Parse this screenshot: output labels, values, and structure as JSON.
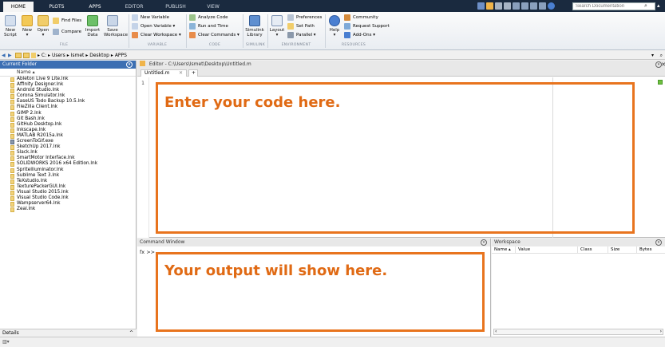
{
  "tabs": [
    {
      "label": "HOME"
    },
    {
      "label": "PLOTS"
    },
    {
      "label": "APPS"
    },
    {
      "label": "EDITOR"
    },
    {
      "label": "PUBLISH"
    },
    {
      "label": "VIEW"
    }
  ],
  "search": {
    "placeholder": "Search Documentation"
  },
  "ribbon": {
    "new_script": "New Script",
    "new": "New",
    "open": "Open",
    "find_files": "Find Files",
    "compare": "Compare",
    "import_data": "Import Data",
    "save_workspace": "Save Workspace",
    "new_variable": "New Variable",
    "open_variable": "Open Variable",
    "clear_workspace": "Clear Workspace",
    "analyze_code": "Analyze Code",
    "run_and_time": "Run and Time",
    "clear_commands": "Clear Commands",
    "simulink_library": "Simulink Library",
    "layout": "Layout",
    "preferences": "Preferences",
    "set_path": "Set Path",
    "parallel": "Parallel",
    "help": "Help",
    "community": "Community",
    "request_support": "Request Support",
    "add_ons": "Add-Ons",
    "sections": {
      "file": "FILE",
      "variable": "VARIABLE",
      "code": "CODE",
      "simulink": "SIMULINK",
      "environment": "ENVIRONMENT",
      "resources": "RESOURCES"
    }
  },
  "address": {
    "crumbs": [
      "C:",
      "Users",
      "Ismet",
      "Desktop",
      "APPS"
    ]
  },
  "current_folder": {
    "title": "Current Folder",
    "name_col": "Name",
    "files": [
      {
        "name": "Ableton Live 9 Lite.lnk",
        "icon": "file-icon"
      },
      {
        "name": "Affinity Designer.lnk",
        "icon": "file-icon"
      },
      {
        "name": "Android Studio.lnk",
        "icon": "file-icon"
      },
      {
        "name": "Corona Simulator.lnk",
        "icon": "file-icon"
      },
      {
        "name": "EaseUS Todo Backup 10.5.lnk",
        "icon": "file-icon"
      },
      {
        "name": "FileZilla Client.lnk",
        "icon": "file-icon"
      },
      {
        "name": "GIMP 2.lnk",
        "icon": "file-icon"
      },
      {
        "name": "Git Bash.lnk",
        "icon": "file-icon"
      },
      {
        "name": "GitHub Desktop.lnk",
        "icon": "file-icon"
      },
      {
        "name": "Inkscape.lnk",
        "icon": "file-icon"
      },
      {
        "name": "MATLAB R2015a.lnk",
        "icon": "file-icon"
      },
      {
        "name": "ScreenToGif.exe",
        "icon": "exe-icon"
      },
      {
        "name": "SketchUp 2017.lnk",
        "icon": "file-icon"
      },
      {
        "name": "Slack.lnk",
        "icon": "file-icon"
      },
      {
        "name": "SmartMotor Interface.lnk",
        "icon": "file-icon"
      },
      {
        "name": "SOLIDWORKS 2016 x64 Edition.lnk",
        "icon": "file-icon"
      },
      {
        "name": "SpriteIlluminator.lnk",
        "icon": "file-icon"
      },
      {
        "name": "Sublime Text 3.lnk",
        "icon": "file-icon"
      },
      {
        "name": "TeXstudio.lnk",
        "icon": "file-icon"
      },
      {
        "name": "TexturePackerGUI.lnk",
        "icon": "file-icon"
      },
      {
        "name": "Visual Studio 2015.lnk",
        "icon": "file-icon"
      },
      {
        "name": "Visual Studio Code.lnk",
        "icon": "file-icon"
      },
      {
        "name": "Wampserver64.lnk",
        "icon": "file-icon"
      },
      {
        "name": "Zeal.lnk",
        "icon": "file-icon"
      }
    ],
    "details": "Details"
  },
  "editor": {
    "title": "Editor - C:\\Users\\Ismet\\Desktop\\Untitled.m",
    "tab_label": "Untitled.m",
    "line_number": "1",
    "callout": "Enter your code here."
  },
  "command_window": {
    "title": "Command Window",
    "prompt": "fx >>",
    "callout": "Your output will show here."
  },
  "workspace": {
    "title": "Workspace",
    "columns": [
      "Name",
      "Value",
      "Class",
      "Size",
      "Bytes"
    ]
  },
  "colors": {
    "accent": "#3c6fb3",
    "callout": "#e8741e",
    "tabbar": "#1a2a3f"
  }
}
